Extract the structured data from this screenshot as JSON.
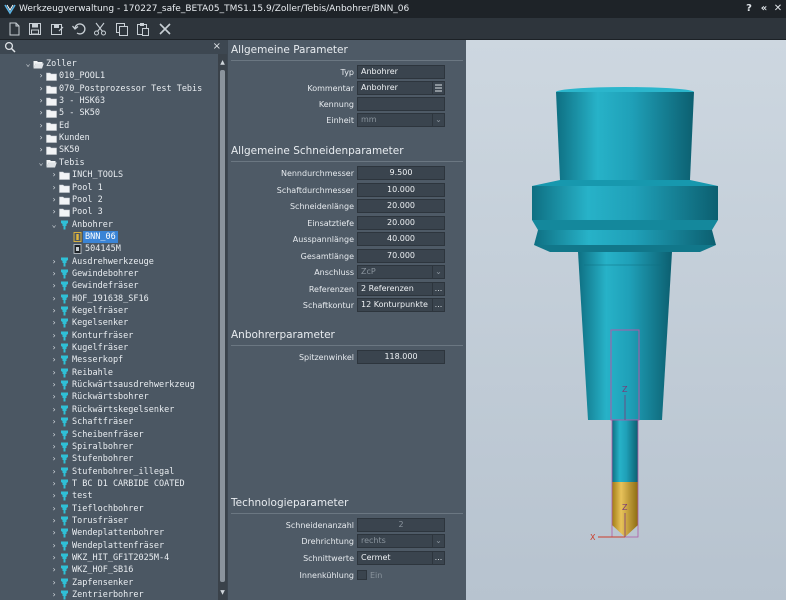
{
  "window": {
    "title": "Werkzeugverwaltung - 170227_safe_BETA05_TMS1.15.9/Zoller/Tebis/Anbohrer/BNN_06",
    "buttons": [
      "?",
      "«",
      "✕"
    ]
  },
  "toolbar": {
    "icons": [
      "new-icon",
      "save-icon",
      "save-as-icon",
      "undo-icon",
      "cut-icon",
      "copy-icon",
      "paste-icon",
      "delete-icon"
    ]
  },
  "tree": {
    "close_label": "×",
    "items": [
      {
        "label": "Zoller",
        "level": 1,
        "expanded": true,
        "icon": "folder-open"
      },
      {
        "label": "010_POOL1",
        "level": 2,
        "expanded": false,
        "icon": "folder"
      },
      {
        "label": "070_Postprozessor Test Tebis",
        "level": 2,
        "expanded": false,
        "icon": "folder"
      },
      {
        "label": "3 - HSK63",
        "level": 2,
        "expanded": false,
        "icon": "folder"
      },
      {
        "label": "5 - SK50",
        "level": 2,
        "expanded": false,
        "icon": "folder"
      },
      {
        "label": "Ed",
        "level": 2,
        "expanded": false,
        "icon": "folder"
      },
      {
        "label": "Kunden",
        "level": 2,
        "expanded": false,
        "icon": "folder"
      },
      {
        "label": "SK50",
        "level": 2,
        "expanded": false,
        "icon": "folder"
      },
      {
        "label": "Tebis",
        "level": 2,
        "expanded": true,
        "icon": "folder-open"
      },
      {
        "label": "INCH_TOOLS",
        "level": 3,
        "expanded": false,
        "icon": "folder"
      },
      {
        "label": "Pool 1",
        "level": 3,
        "expanded": false,
        "icon": "folder"
      },
      {
        "label": "Pool 2",
        "level": 3,
        "expanded": false,
        "icon": "folder"
      },
      {
        "label": "Pool 3",
        "level": 3,
        "expanded": false,
        "icon": "folder"
      },
      {
        "label": "Anbohrer",
        "level": 3,
        "expanded": true,
        "icon": "tool"
      },
      {
        "label": "BNN_06",
        "level": 4,
        "leaf": true,
        "icon": "tool-item",
        "selected": true
      },
      {
        "label": "504145M",
        "level": 4,
        "leaf": true,
        "icon": "tool-item-dark"
      },
      {
        "label": "Ausdrehwerkzeuge",
        "level": 3,
        "expanded": false,
        "icon": "tool"
      },
      {
        "label": "Gewindebohrer",
        "level": 3,
        "expanded": false,
        "icon": "tool"
      },
      {
        "label": "Gewindefräser",
        "level": 3,
        "expanded": false,
        "icon": "tool"
      },
      {
        "label": "HOF_191638_SF16",
        "level": 3,
        "expanded": false,
        "icon": "tool"
      },
      {
        "label": "Kegelfräser",
        "level": 3,
        "expanded": false,
        "icon": "tool"
      },
      {
        "label": "Kegelsenker",
        "level": 3,
        "expanded": false,
        "icon": "tool"
      },
      {
        "label": "Konturfräser",
        "level": 3,
        "expanded": false,
        "icon": "tool"
      },
      {
        "label": "Kugelfräser",
        "level": 3,
        "expanded": false,
        "icon": "tool"
      },
      {
        "label": "Messerkopf",
        "level": 3,
        "expanded": false,
        "icon": "tool"
      },
      {
        "label": "Reibahle",
        "level": 3,
        "expanded": false,
        "icon": "tool"
      },
      {
        "label": "Rückwärtsausdrehwerkzeug",
        "level": 3,
        "expanded": false,
        "icon": "tool"
      },
      {
        "label": "Rückwärtsbohrer",
        "level": 3,
        "expanded": false,
        "icon": "tool"
      },
      {
        "label": "Rückwärtskegelsenker",
        "level": 3,
        "expanded": false,
        "icon": "tool"
      },
      {
        "label": "Schaftfräser",
        "level": 3,
        "expanded": false,
        "icon": "tool"
      },
      {
        "label": "Scheibenfräser",
        "level": 3,
        "expanded": false,
        "icon": "tool"
      },
      {
        "label": "Spiralbohrer",
        "level": 3,
        "expanded": false,
        "icon": "tool"
      },
      {
        "label": "Stufenbohrer",
        "level": 3,
        "expanded": false,
        "icon": "tool"
      },
      {
        "label": "Stufenbohrer_illegal",
        "level": 3,
        "expanded": false,
        "icon": "tool"
      },
      {
        "label": "T BC D1 CARBIDE COATED",
        "level": 3,
        "expanded": false,
        "icon": "tool"
      },
      {
        "label": "test",
        "level": 3,
        "expanded": false,
        "icon": "tool"
      },
      {
        "label": "Tieflochbohrer",
        "level": 3,
        "expanded": false,
        "icon": "tool"
      },
      {
        "label": "Torusfräser",
        "level": 3,
        "expanded": false,
        "icon": "tool"
      },
      {
        "label": "Wendeplattenbohrer",
        "level": 3,
        "expanded": false,
        "icon": "tool"
      },
      {
        "label": "Wendeplattenfräser",
        "level": 3,
        "expanded": false,
        "icon": "tool"
      },
      {
        "label": "WKZ_HIT_GF1T2025M-4",
        "level": 3,
        "expanded": false,
        "icon": "tool"
      },
      {
        "label": "WKZ_HOF_SB16",
        "level": 3,
        "expanded": false,
        "icon": "tool"
      },
      {
        "label": "Zapfensenker",
        "level": 3,
        "expanded": false,
        "icon": "tool"
      },
      {
        "label": "Zentrierbohrer",
        "level": 3,
        "expanded": false,
        "icon": "tool"
      }
    ]
  },
  "params": {
    "sections": {
      "general": "Allgemeine Parameter",
      "cutting": "Allgemeine Schneidenparameter",
      "spot": "Anbohrerparameter",
      "tech": "Technologieparameter"
    },
    "general": {
      "typ_label": "Typ",
      "typ_value": "Anbohrer",
      "kommentar_label": "Kommentar",
      "kommentar_value": "Anbohrer",
      "kennung_label": "Kennung",
      "kennung_value": "",
      "einheit_label": "Einheit",
      "einheit_value": "mm"
    },
    "cutting": {
      "nenn_label": "Nenndurchmesser",
      "nenn_value": "9.500",
      "schaft_label": "Schaftdurchmesser",
      "schaft_value": "10.000",
      "schneid_label": "Schneidenlänge",
      "schneid_value": "20.000",
      "einsatz_label": "Einsatztiefe",
      "einsatz_value": "20.000",
      "ausspann_label": "Ausspannlänge",
      "ausspann_value": "40.000",
      "gesamt_label": "Gesamtlänge",
      "gesamt_value": "70.000",
      "anschluss_label": "Anschluss",
      "anschluss_value": "ZcP",
      "referenzen_label": "Referenzen",
      "referenzen_value": "2 Referenzen",
      "schaftkontur_label": "Schaftkontur",
      "schaftkontur_value": "12 Konturpunkte"
    },
    "spot": {
      "spitzen_label": "Spitzenwinkel",
      "spitzen_value": "118.000"
    },
    "tech": {
      "anzahl_label": "Schneidenanzahl",
      "anzahl_value": "2",
      "dreh_label": "Drehrichtung",
      "dreh_value": "rechts",
      "schnitt_label": "Schnittwerte",
      "schnitt_value": "Cermet",
      "kuehl_label": "Innenkühlung",
      "kuehl_value": "Ein"
    },
    "button_ellipsis": "...",
    "dropdown_arrow": "⌄"
  },
  "viewport": {
    "axis_z": "Z",
    "axis_x": "X",
    "colors": {
      "body": "#1fa0b8",
      "tip": "#d4a82a",
      "background": "#c3ced9"
    }
  }
}
